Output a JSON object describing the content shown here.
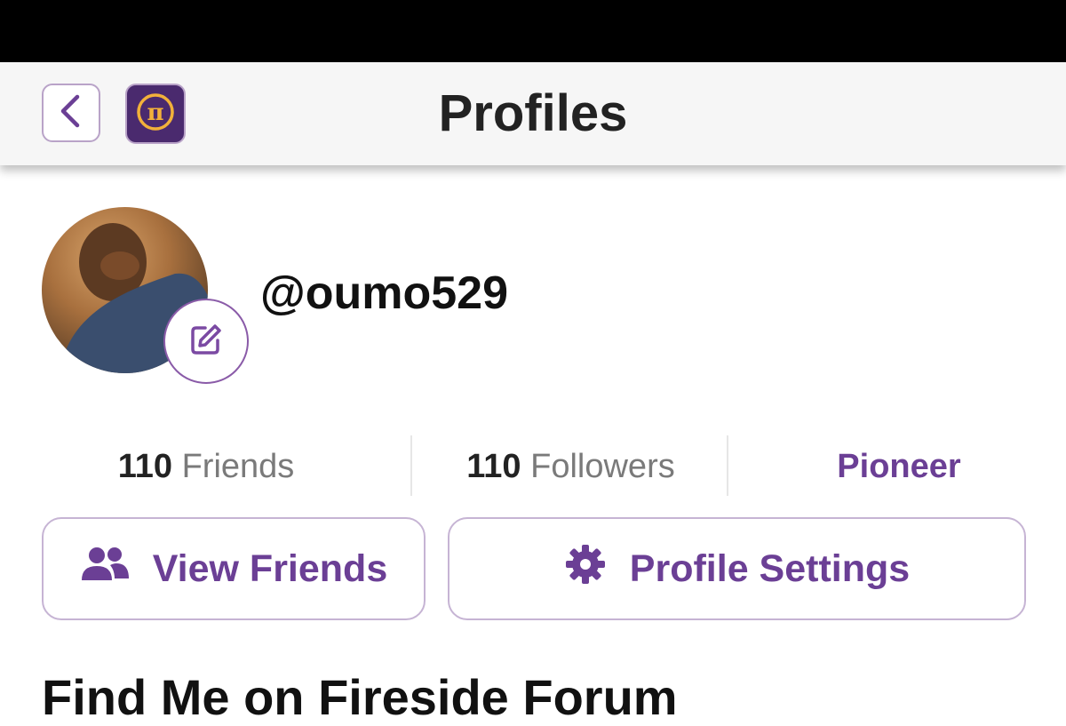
{
  "header": {
    "title": "Profiles",
    "back_icon": "chevron-left-icon",
    "logo_icon": "pi-network-logo-icon",
    "logo_symbol": "π"
  },
  "profile": {
    "username": "@oumo529",
    "edit_icon": "pencil-edit-icon"
  },
  "stats": {
    "friends": {
      "count": "110",
      "label": "Friends"
    },
    "followers": {
      "count": "110",
      "label": "Followers"
    },
    "role": "Pioneer"
  },
  "actions": {
    "view_friends": {
      "label": "View Friends",
      "icon": "people-icon"
    },
    "profile_settings": {
      "label": "Profile Settings",
      "icon": "gear-icon"
    }
  },
  "sections": {
    "fireside_title": "Find Me on Fireside Forum"
  },
  "colors": {
    "accent": "#6b3f95",
    "logo_bg": "#4a2a6e",
    "logo_fg": "#f2b13a",
    "status_bar": "#000000",
    "header_bg": "#f6f6f6"
  }
}
